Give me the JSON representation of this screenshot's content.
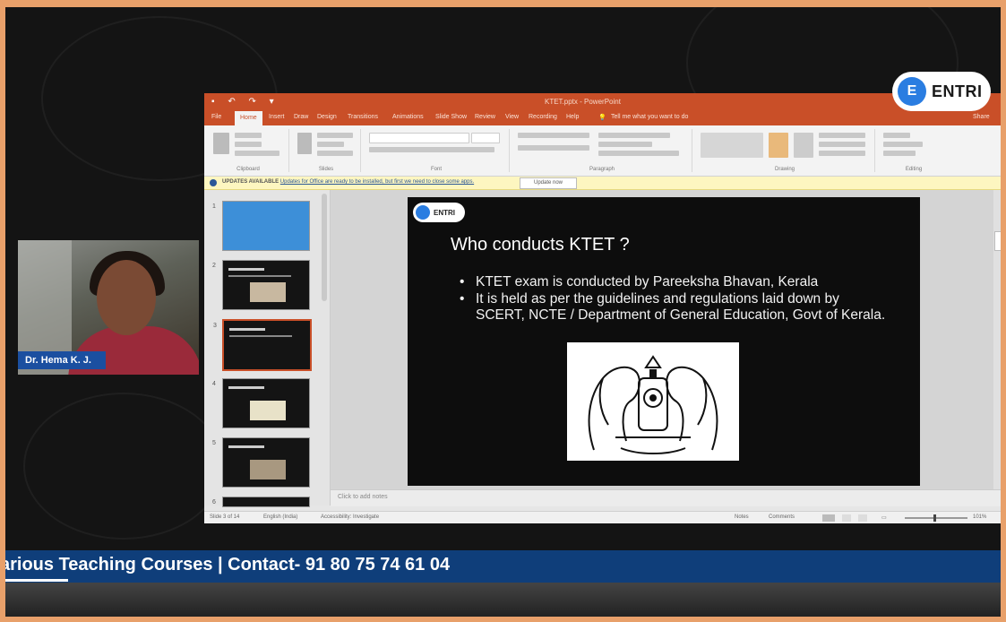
{
  "brand": {
    "name": "ENTRI",
    "logo_letter": "E",
    "accent": "#2a7de1"
  },
  "presenter": {
    "name": "Dr. Hema K. J."
  },
  "app": {
    "window_title": "KTET.pptx - PowerPoint",
    "tabs": [
      "File",
      "Home",
      "Insert",
      "Draw",
      "Design",
      "Transitions",
      "Animations",
      "Slide Show",
      "Review",
      "View",
      "Recording",
      "Help"
    ],
    "tell_me": "Tell me what you want to do",
    "share": "Share",
    "ribbon_groups": [
      "Clipboard",
      "Slides",
      "Font",
      "Paragraph",
      "Drawing",
      "Editing"
    ],
    "update_bar": {
      "label": "UPDATES AVAILABLE",
      "message": "Updates for Office are ready to be installed, but first we need to close some apps.",
      "button": "Update now"
    },
    "notes_placeholder": "Click to add notes",
    "status": {
      "slide_info": "Slide 3 of 14",
      "language": "English (India)",
      "accessibility": "Accessibility: Investigate",
      "notes": "Notes",
      "comments": "Comments",
      "zoom": "101%"
    },
    "thumbnails": [
      {
        "num": "1"
      },
      {
        "num": "2"
      },
      {
        "num": "3",
        "selected": true
      },
      {
        "num": "4"
      },
      {
        "num": "5"
      },
      {
        "num": "6"
      }
    ]
  },
  "slide": {
    "logo_text": "ENTRI",
    "title": "Who conducts KTET ?",
    "bullets": [
      "KTET exam is conducted by Pareeksha Bhavan, Kerala",
      "It is held as per the guidelines and regulations laid down by SCERT, NCTE / Department of General Education, Govt of Kerala."
    ]
  },
  "ticker": {
    "text": "arious Teaching Courses | Contact- 91 80 75 74 61 04"
  }
}
